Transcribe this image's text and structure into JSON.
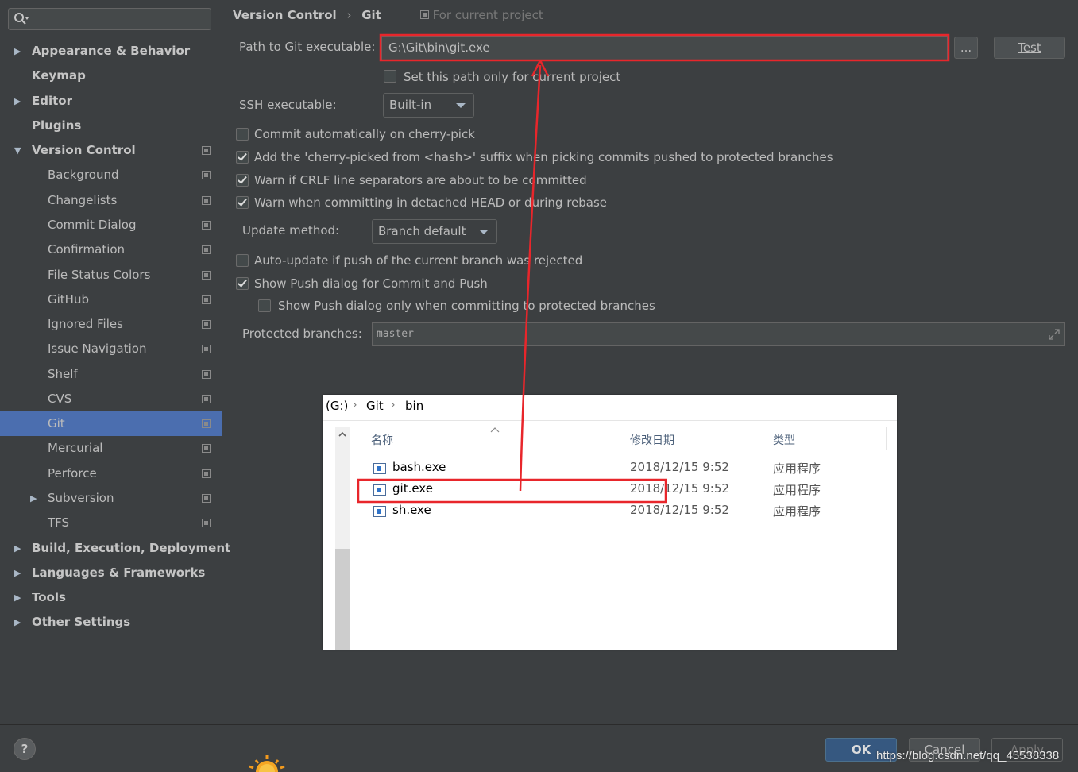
{
  "sidebar": {
    "search_placeholder": "",
    "items": [
      {
        "label": "Appearance & Behavior",
        "level": 0,
        "arrow": "▶",
        "bold": true
      },
      {
        "label": "Keymap",
        "level": 0,
        "arrow": "",
        "bold": true
      },
      {
        "label": "Editor",
        "level": 0,
        "arrow": "▶",
        "bold": true
      },
      {
        "label": "Plugins",
        "level": 0,
        "arrow": "",
        "bold": true
      },
      {
        "label": "Version Control",
        "level": 0,
        "arrow": "▼",
        "bold": true,
        "proj": true
      },
      {
        "label": "Background",
        "level": 1,
        "arrow": "",
        "proj": true
      },
      {
        "label": "Changelists",
        "level": 1,
        "arrow": "",
        "proj": true
      },
      {
        "label": "Commit Dialog",
        "level": 1,
        "arrow": "",
        "proj": true
      },
      {
        "label": "Confirmation",
        "level": 1,
        "arrow": "",
        "proj": true
      },
      {
        "label": "File Status Colors",
        "level": 1,
        "arrow": "",
        "proj": true
      },
      {
        "label": "GitHub",
        "level": 1,
        "arrow": "",
        "proj": true
      },
      {
        "label": "Ignored Files",
        "level": 1,
        "arrow": "",
        "proj": true
      },
      {
        "label": "Issue Navigation",
        "level": 1,
        "arrow": "",
        "proj": true
      },
      {
        "label": "Shelf",
        "level": 1,
        "arrow": "",
        "proj": true
      },
      {
        "label": "CVS",
        "level": 1,
        "arrow": "",
        "proj": true
      },
      {
        "label": "Git",
        "level": 1,
        "arrow": "",
        "proj": true,
        "selected": true
      },
      {
        "label": "Mercurial",
        "level": 1,
        "arrow": "",
        "proj": true
      },
      {
        "label": "Perforce",
        "level": 1,
        "arrow": "",
        "proj": true
      },
      {
        "label": "Subversion",
        "level": 1,
        "arrow": "▶",
        "proj": true
      },
      {
        "label": "TFS",
        "level": 1,
        "arrow": "",
        "proj": true
      },
      {
        "label": "Build, Execution, Deployment",
        "level": 0,
        "arrow": "▶",
        "bold": true
      },
      {
        "label": "Languages & Frameworks",
        "level": 0,
        "arrow": "▶",
        "bold": true
      },
      {
        "label": "Tools",
        "level": 0,
        "arrow": "▶",
        "bold": true
      },
      {
        "label": "Other Settings",
        "level": 0,
        "arrow": "▶",
        "bold": true
      }
    ]
  },
  "breadcrumb": {
    "part1": "Version Control",
    "sep": "›",
    "part2": "Git",
    "scope": "For current project"
  },
  "git": {
    "path_label": "Path to Git executable:",
    "path_value": "G:\\Git\\bin\\git.exe",
    "browse_label": "...",
    "test_label": "Test",
    "current_project_label": "Set this path only for current project",
    "ssh_label": "SSH executable:",
    "ssh_value": "Built-in",
    "commit_auto_label": "Commit automatically on cherry-pick",
    "cherry_suffix_label": "Add the 'cherry-picked from <hash>' suffix when picking commits pushed to protected branches",
    "crlf_label": "Warn if CRLF line separators are about to be committed",
    "detached_label": "Warn when committing in detached HEAD or during rebase",
    "update_label": "Update method:",
    "update_value": "Branch default",
    "auto_update_label": "Auto-update if push of the current branch was rejected",
    "show_push_label": "Show Push dialog for Commit and Push",
    "show_push_protected_label": "Show Push dialog only when committing to protected branches",
    "protected_label": "Protected branches:",
    "protected_value": "master"
  },
  "explorer": {
    "crumb": [
      "(G:)",
      "Git",
      "bin"
    ],
    "crumb_sep": "›",
    "col_name": "名称",
    "col_date": "修改日期",
    "col_type": "类型",
    "files": [
      {
        "name": "bash.exe",
        "date": "2018/12/15 9:52",
        "type": "应用程序"
      },
      {
        "name": "git.exe",
        "date": "2018/12/15 9:52",
        "type": "应用程序"
      },
      {
        "name": "sh.exe",
        "date": "2018/12/15 9:52",
        "type": "应用程序"
      }
    ]
  },
  "footer": {
    "help": "?",
    "ok": "OK",
    "cancel": "Cancel",
    "apply": "Apply",
    "watermark": "https://blog.csdn.net/qq_45538338"
  },
  "colors": {
    "annotation": "#e8262b",
    "selection": "#4b6eaf",
    "ok_button": "#365880"
  }
}
